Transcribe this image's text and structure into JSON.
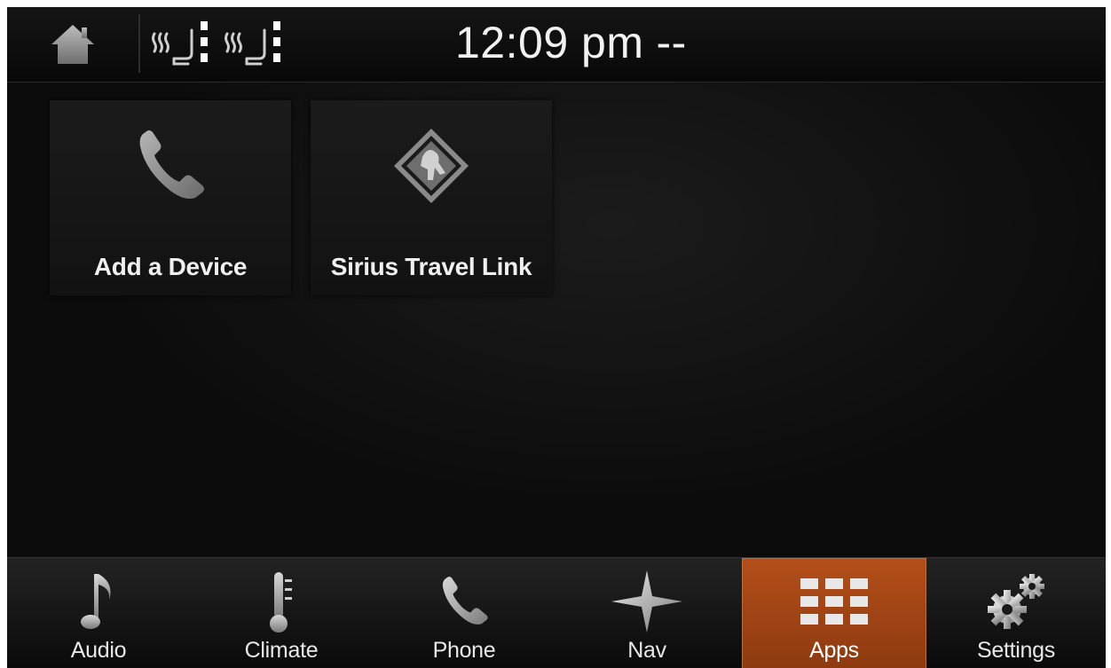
{
  "status_bar": {
    "time": "12:09 pm",
    "time_suffix": "--",
    "icons": [
      "home-icon",
      "driver-seat-heat-icon",
      "passenger-seat-heat-icon"
    ]
  },
  "apps": [
    {
      "label": "Add a Device",
      "icon": "phone-icon"
    },
    {
      "label": "Sirius Travel Link",
      "icon": "sirius-travel-link-icon"
    }
  ],
  "nav": {
    "items": [
      {
        "label": "Audio",
        "icon": "music-note-icon"
      },
      {
        "label": "Climate",
        "icon": "thermometer-icon"
      },
      {
        "label": "Phone",
        "icon": "phone-icon"
      },
      {
        "label": "Nav",
        "icon": "compass-star-icon"
      },
      {
        "label": "Apps",
        "icon": "apps-grid-icon",
        "active": true
      },
      {
        "label": "Settings",
        "icon": "gears-icon"
      }
    ]
  },
  "colors": {
    "active_tab": "#b44f1a",
    "background": "#0d0d0d",
    "text": "#f0f0f0"
  }
}
